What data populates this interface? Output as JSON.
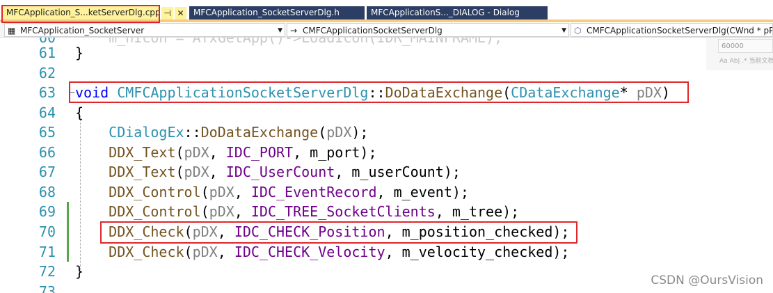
{
  "tabs": [
    {
      "label": "MFCApplication_S...ketServerDlg.cpp",
      "active": true
    },
    {
      "label": "MFCApplication_SocketServerDlg.h",
      "active": false
    },
    {
      "label": "MFCApplicationS..._DIALOG - Dialog",
      "active": false
    }
  ],
  "tab_pin_glyph": "⊣",
  "tab_close_glyph": "✕",
  "navbar": {
    "project": "MFCApplication_SocketServer",
    "class": "CMFCApplicationSocketServerDlg",
    "member": "CMFCApplicationSocketServerDlg(CWnd * pPa"
  },
  "find": {
    "value": "60000",
    "options": "Aa Ab| .*   当前文档"
  },
  "lines": [
    {
      "no": "61",
      "text": "}"
    },
    {
      "no": "62",
      "text": ""
    },
    {
      "no": "63",
      "text": "void CMFCApplicationSocketServerDlg::DoDataExchange(CDataExchange* pDX)"
    },
    {
      "no": "64",
      "text": "{"
    },
    {
      "no": "65",
      "text": "    CDialogEx::DoDataExchange(pDX);"
    },
    {
      "no": "66",
      "text": "    DDX_Text(pDX, IDC_PORT, m_port);"
    },
    {
      "no": "67",
      "text": "    DDX_Text(pDX, IDC_UserCount, m_userCount);"
    },
    {
      "no": "68",
      "text": "    DDX_Control(pDX, IDC_EventRecord, m_event);"
    },
    {
      "no": "69",
      "text": "    DDX_Control(pDX, IDC_TREE_SocketClients, m_tree);"
    },
    {
      "no": "70",
      "text": "    DDX_Check(pDX, IDC_CHECK_Position, m_position_checked);"
    },
    {
      "no": "71",
      "text": "    DDX_Check(pDX, IDC_CHECK_Velocity, m_velocity_checked);"
    },
    {
      "no": "72",
      "text": "}"
    },
    {
      "no": "73",
      "text": ""
    }
  ],
  "watermark": "CSDN @OursVision",
  "colors": {
    "highlight": "#e0262a",
    "keyword": "#0000ff",
    "type": "#2b91af",
    "function": "#74531f",
    "macro": "#6f008a"
  }
}
